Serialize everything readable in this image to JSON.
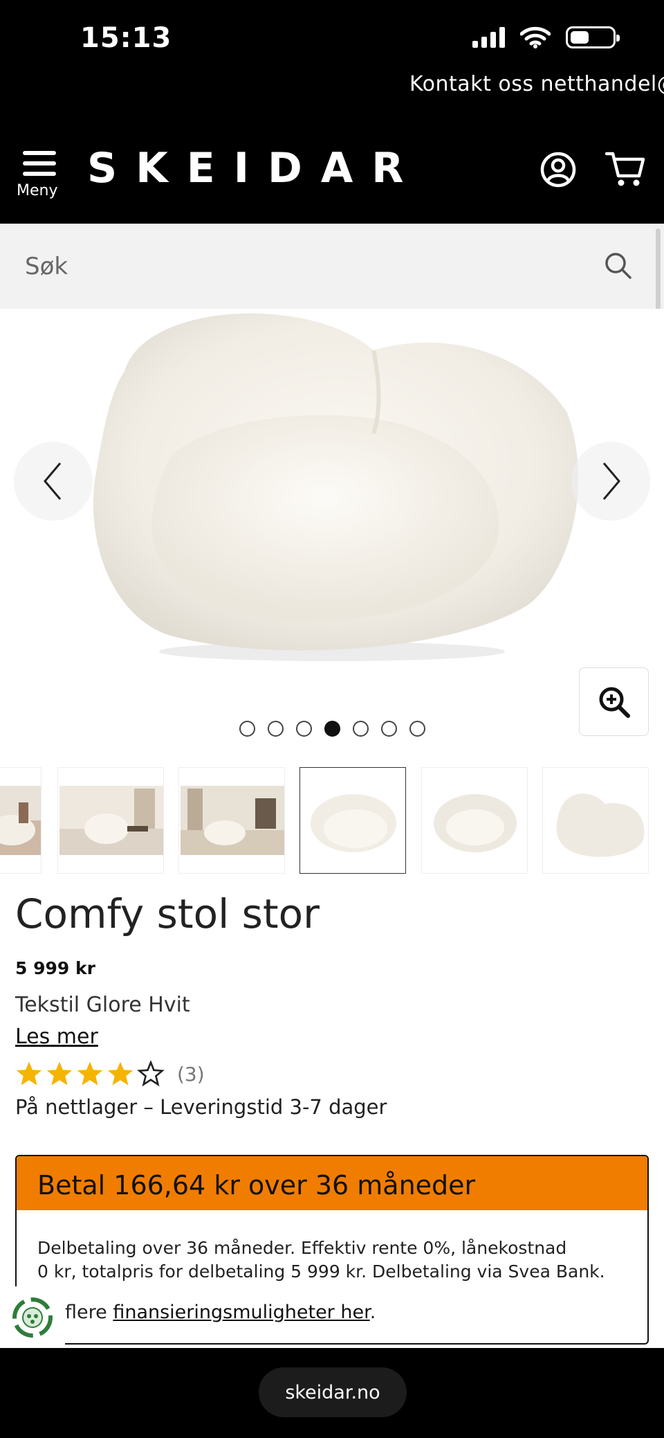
{
  "status": {
    "time": "15:13"
  },
  "contact_bar": {
    "text": "Kontakt oss netthandel@s"
  },
  "header": {
    "menu_label": "Meny",
    "logo": "SKEIDAR",
    "account_icon": "user-circle-icon",
    "cart_icon": "cart-icon"
  },
  "search": {
    "placeholder": "Søk",
    "icon": "search-icon"
  },
  "gallery": {
    "image_count": 7,
    "active_index": 4,
    "prev_icon": "chevron-left-icon",
    "next_icon": "chevron-right-icon",
    "zoom_icon": "zoom-in-icon"
  },
  "product": {
    "title": "Comfy stol stor",
    "price": "5 999 kr",
    "variant": "Tekstil Glore Hvit",
    "read_more": "Les mer",
    "rating": 4,
    "rating_max": 5,
    "rating_count": "(3)",
    "stock": "På nettlager – Leveringstid 3-7 dager"
  },
  "finance": {
    "heading": "Betal 166,64 kr over 36 måneder",
    "line1": "Delbetaling over 36 måneder. Effektiv rente 0%, lånekostnad",
    "line2": "0 kr, totalpris for delbetaling 5 999 kr. Delbetaling via Svea Bank.",
    "more_prefix": "flere ",
    "more_link": "finansieringsmuligheter her",
    "more_suffix": "."
  },
  "colors": {
    "accent": "#f07d00",
    "header_bg": "#000000",
    "search_bg": "#f2f2f2",
    "star": "#f5b400"
  },
  "browser": {
    "url": "skeidar.no"
  }
}
